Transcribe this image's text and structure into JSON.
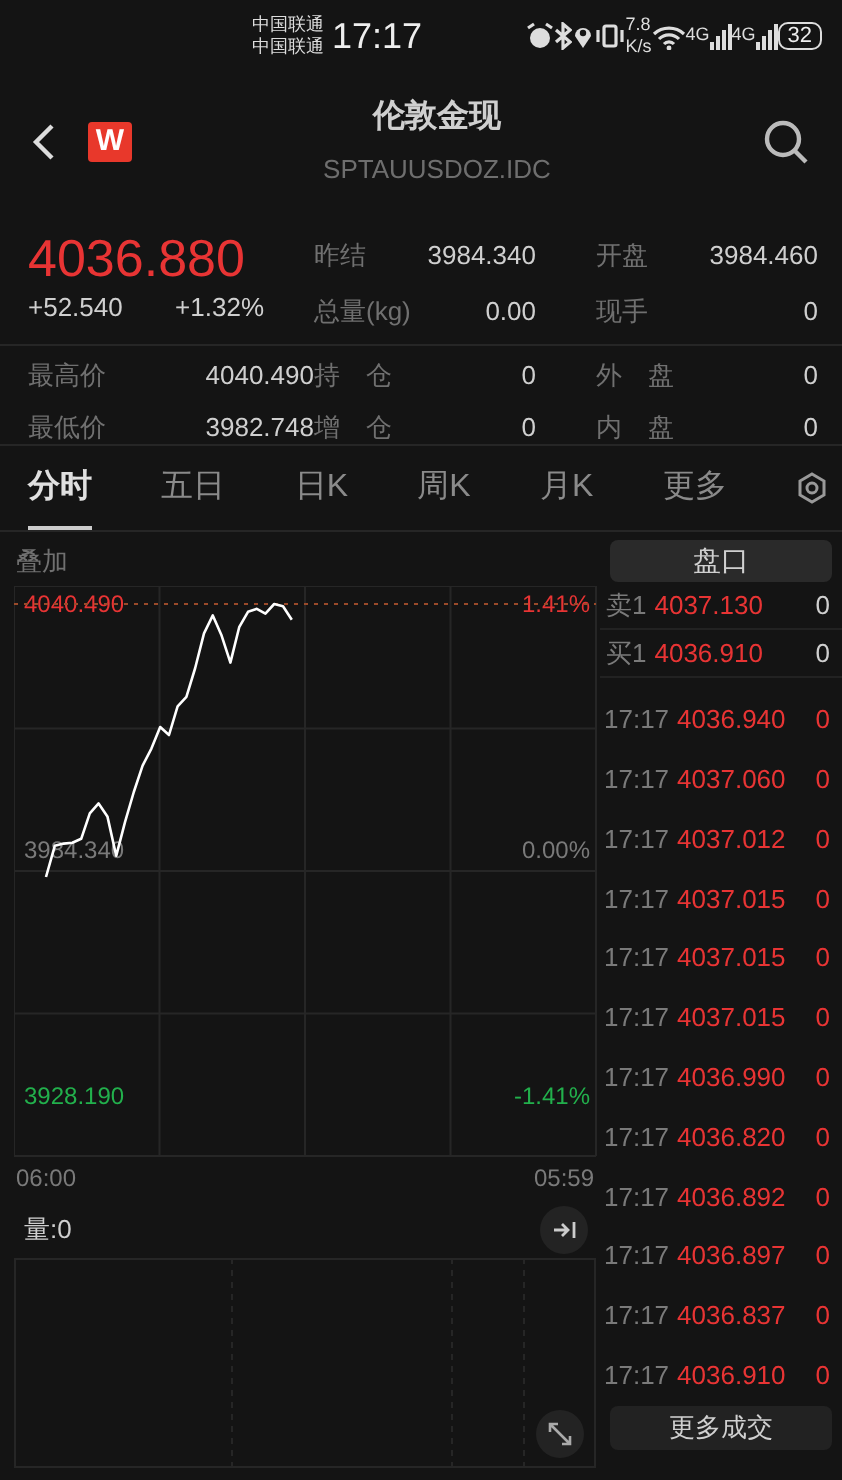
{
  "status_bar": {
    "carriers": [
      "中国联通",
      "中国联通"
    ],
    "time": "17:17",
    "net_speed": [
      "7.8",
      "K/s"
    ],
    "signal_labels": [
      "4G",
      "4G"
    ],
    "battery": "32"
  },
  "header": {
    "logo": "W",
    "title": "伦敦金现",
    "subtitle": "SPTAUUSDOZ.IDC"
  },
  "quote": {
    "price": "4036.880",
    "change": "+52.540",
    "change_pct": "+1.32%",
    "top_stats": [
      {
        "label": "昨结",
        "value": "3984.340"
      },
      {
        "label": "开盘",
        "value": "3984.460"
      },
      {
        "label": "总量(kg)",
        "value": "0.00"
      },
      {
        "label": "现手",
        "value": "0"
      }
    ],
    "bottom_stats": [
      {
        "label": "最高价",
        "value": "4040.490"
      },
      {
        "label": "持　仓",
        "value": "0"
      },
      {
        "label": "外　盘",
        "value": "0"
      },
      {
        "label": "最低价",
        "value": "3982.748"
      },
      {
        "label": "增　仓",
        "value": "0"
      },
      {
        "label": "内　盘",
        "value": "0"
      }
    ]
  },
  "tabs": [
    {
      "label": "分时",
      "selected": true
    },
    {
      "label": "五日",
      "selected": false
    },
    {
      "label": "日K",
      "selected": false
    },
    {
      "label": "周K",
      "selected": false
    },
    {
      "label": "月K",
      "selected": false
    },
    {
      "label": "更多",
      "selected": false
    }
  ],
  "chart": {
    "overlay_label": "叠加",
    "volume_label": "量:0",
    "percent_labels": [
      "1.41%",
      "0.00%",
      "-1.41%"
    ],
    "chart_data": {
      "type": "line",
      "ylim": [
        3914.5,
        4044.6
      ],
      "ref_lines": [
        {
          "axis": "y",
          "value": 4040.49,
          "color": "#9a4a2a"
        }
      ],
      "categories": [
        "06:00",
        null,
        null,
        null,
        null,
        null,
        null,
        null,
        null,
        null,
        null,
        null,
        null,
        null,
        null,
        null,
        null,
        null,
        null,
        null,
        null,
        null,
        null,
        null,
        null,
        null,
        null,
        null,
        null,
        null,
        null,
        null,
        null,
        null,
        null,
        null,
        null,
        null,
        null,
        null,
        null,
        null,
        null,
        null,
        null,
        null,
        null,
        null,
        null,
        null,
        null,
        null,
        null,
        null,
        null,
        null,
        null,
        null,
        null,
        "05:59"
      ],
      "yticks": [
        {
          "value": 4040.49,
          "label": "4040.490"
        },
        {
          "value": 3984.34,
          "label": "3984.340"
        },
        {
          "value": 3928.19,
          "label": "3928.190"
        }
      ],
      "series": [
        {
          "color": "#ffffff",
          "values": [
            3978.2,
            3985.3,
            3985.8,
            3986.0,
            3986.9,
            3992.7,
            3995.0,
            3992.0,
            3983.0,
            3990.7,
            3997.6,
            4003.6,
            4007.5,
            4012.4,
            4010.6,
            4017.1,
            4019.3,
            4025.9,
            4033.8,
            4037.9,
            4033.3,
            4027.1,
            4035.2,
            4038.7,
            4039.4,
            4038.3,
            4040.5,
            4040.0,
            4036.9,
            null,
            null,
            null,
            null,
            null,
            null,
            null,
            null,
            null,
            null,
            null,
            null,
            null,
            null,
            null,
            null,
            null,
            null,
            null,
            null,
            null,
            null,
            null,
            null,
            null,
            null,
            null,
            null,
            null,
            null,
            null
          ]
        }
      ]
    }
  },
  "order_book": {
    "button": "盘口",
    "quotes": [
      {
        "side": "卖1",
        "price": "4037.130",
        "volume": "0"
      },
      {
        "side": "买1",
        "price": "4036.910",
        "volume": "0"
      }
    ],
    "trades": [
      {
        "time": "17:17",
        "price": "4036.940",
        "volume": "0"
      },
      {
        "time": "17:17",
        "price": "4037.060",
        "volume": "0"
      },
      {
        "time": "17:17",
        "price": "4037.012",
        "volume": "0"
      },
      {
        "time": "17:17",
        "price": "4037.015",
        "volume": "0"
      },
      {
        "time": "17:17",
        "price": "4037.015",
        "volume": "0"
      },
      {
        "time": "17:17",
        "price": "4037.015",
        "volume": "0"
      },
      {
        "time": "17:17",
        "price": "4036.990",
        "volume": "0"
      },
      {
        "time": "17:17",
        "price": "4036.820",
        "volume": "0"
      },
      {
        "time": "17:17",
        "price": "4036.892",
        "volume": "0"
      },
      {
        "time": "17:17",
        "price": "4036.897",
        "volume": "0"
      },
      {
        "time": "17:17",
        "price": "4036.837",
        "volume": "0"
      },
      {
        "time": "17:17",
        "price": "4036.910",
        "volume": "0"
      }
    ],
    "more_button": "更多成交"
  }
}
